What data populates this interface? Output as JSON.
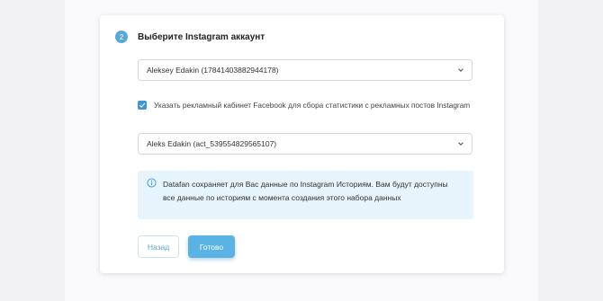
{
  "step": {
    "number": "2",
    "title": "Выберите Instagram аккаунт"
  },
  "instagram_select": {
    "value": "Aleksey Edakin (17841403882944178)",
    "icon": "chevron-down-icon"
  },
  "ad_account_checkbox": {
    "checked": true,
    "label": "Указать рекламный кабинет Facebook для сбора статистики с рекламных постов Instagram"
  },
  "ad_account_select": {
    "value": "Aleks Edakin (act_539554829565107)",
    "icon": "chevron-down-icon"
  },
  "info": {
    "icon": "info-icon",
    "text": "Datafan сохраняет для Вас данные по Instagram Историям. Вам будут доступны все данные по историям с момента создания этого набора данных"
  },
  "buttons": {
    "back_label": "Назад",
    "done_label": "Готово"
  },
  "colors": {
    "accent": "#5ab2e5",
    "checkbox": "#3d95d5",
    "info_bg": "#e6f4fc"
  }
}
